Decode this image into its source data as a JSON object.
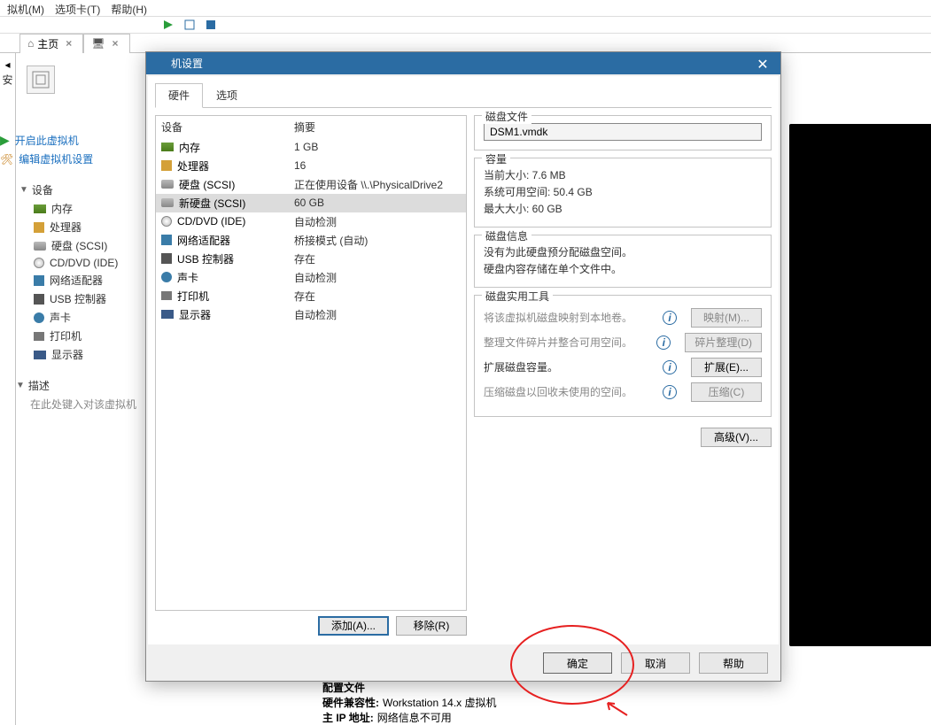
{
  "menu": {
    "vm": "拟机(M)",
    "tabs": "选项卡(T)",
    "help": "帮助(H)"
  },
  "tabs": {
    "home": "主页"
  },
  "sidebar": {
    "label": "安"
  },
  "vm": {
    "start": "开启此虚拟机",
    "edit": "编辑虚拟机设置",
    "devices_header": "设备",
    "devices": [
      {
        "name": "内存"
      },
      {
        "name": "处理器"
      },
      {
        "name": "硬盘 (SCSI)"
      },
      {
        "name": "CD/DVD (IDE)"
      },
      {
        "name": "网络适配器"
      },
      {
        "name": "USB 控制器"
      },
      {
        "name": "声卡"
      },
      {
        "name": "打印机"
      },
      {
        "name": "显示器"
      }
    ],
    "desc_header": "描述",
    "desc_placeholder": "在此处键入对该虚拟机"
  },
  "bottom": {
    "config": "配置文件",
    "compat_label": "硬件兼容性:",
    "compat_value": "Workstation 14.x 虚拟机",
    "ip_label": "主 IP 地址:",
    "ip_value": "网络信息不可用"
  },
  "dialog": {
    "title": "机设置",
    "tab_hw": "硬件",
    "tab_opt": "选项",
    "col_device": "设备",
    "col_summary": "摘要",
    "rows": [
      {
        "name": "内存",
        "summary": "1 GB",
        "icon": "ic-mem"
      },
      {
        "name": "处理器",
        "summary": "16",
        "icon": "ic-cpu"
      },
      {
        "name": "硬盘 (SCSI)",
        "summary": "正在使用设备 \\\\.\\PhysicalDrive2",
        "icon": "ic-disk"
      },
      {
        "name": "新硬盘 (SCSI)",
        "summary": "60 GB",
        "icon": "ic-disk",
        "selected": true
      },
      {
        "name": "CD/DVD (IDE)",
        "summary": "自动检测",
        "icon": "ic-cd"
      },
      {
        "name": "网络适配器",
        "summary": "桥接模式 (自动)",
        "icon": "ic-net"
      },
      {
        "name": "USB 控制器",
        "summary": "存在",
        "icon": "ic-usb"
      },
      {
        "name": "声卡",
        "summary": "自动检测",
        "icon": "ic-sound"
      },
      {
        "name": "打印机",
        "summary": "存在",
        "icon": "ic-print"
      },
      {
        "name": "显示器",
        "summary": "自动检测",
        "icon": "ic-display"
      }
    ],
    "add": "添加(A)...",
    "remove": "移除(R)",
    "detail": {
      "diskfile_legend": "磁盘文件",
      "diskfile_value": "DSM1.vmdk",
      "capacity_legend": "容量",
      "current": "当前大小: 7.6 MB",
      "avail": "系统可用空间: 50.4 GB",
      "max": "最大大小: 60 GB",
      "info_legend": "磁盘信息",
      "info1": "没有为此硬盘预分配磁盘空间。",
      "info2": "硬盘内容存储在单个文件中。",
      "util_legend": "磁盘实用工具",
      "map_hint": "将该虚拟机磁盘映射到本地卷。",
      "map_btn": "映射(M)...",
      "defrag_hint": "整理文件碎片并整合可用空间。",
      "defrag_btn": "碎片整理(D)",
      "expand_hint": "扩展磁盘容量。",
      "expand_btn": "扩展(E)...",
      "compress_hint": "压缩磁盘以回收未使用的空间。",
      "compress_btn": "压缩(C)",
      "advanced": "高级(V)..."
    },
    "ok": "确定",
    "cancel": "取消",
    "help": "帮助"
  }
}
